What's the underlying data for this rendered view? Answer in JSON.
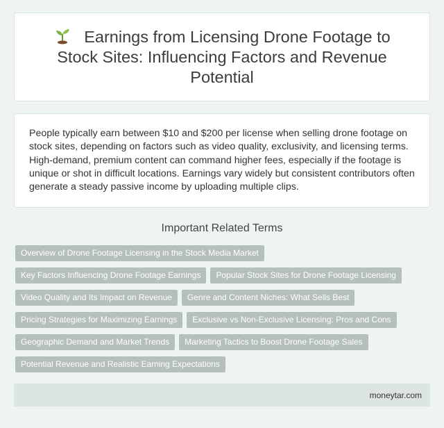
{
  "header": {
    "icon": "sprout-icon",
    "title": "Earnings from Licensing Drone Footage to Stock Sites: Influencing Factors and Revenue Potential"
  },
  "summary": {
    "text": "People typically earn between $10 and $200 per license when selling drone footage on stock sites, depending on factors such as video quality, exclusivity, and licensing terms. High-demand, premium content can command higher fees, especially if the footage is unique or shot in difficult locations. Earnings vary widely but consistent contributors often generate a steady passive income by uploading multiple clips."
  },
  "related": {
    "heading": "Important Related Terms",
    "terms": [
      "Overview of Drone Footage Licensing in the Stock Media Market",
      "Key Factors Influencing Drone Footage Earnings",
      "Popular Stock Sites for Drone Footage Licensing",
      "Video Quality and Its Impact on Revenue",
      "Genre and Content Niches: What Sells Best",
      "Pricing Strategies for Maximizing Earnings",
      "Exclusive vs Non-Exclusive Licensing: Pros and Cons",
      "Geographic Demand and Market Trends",
      "Marketing Tactics to Boost Drone Footage Sales",
      "Potential Revenue and Realistic Earning Expectations"
    ]
  },
  "footer": {
    "site": "moneytar.com"
  },
  "colors": {
    "background": "#eef5f1",
    "tag": "#b5c0bd",
    "footer": "#dde5e1"
  }
}
